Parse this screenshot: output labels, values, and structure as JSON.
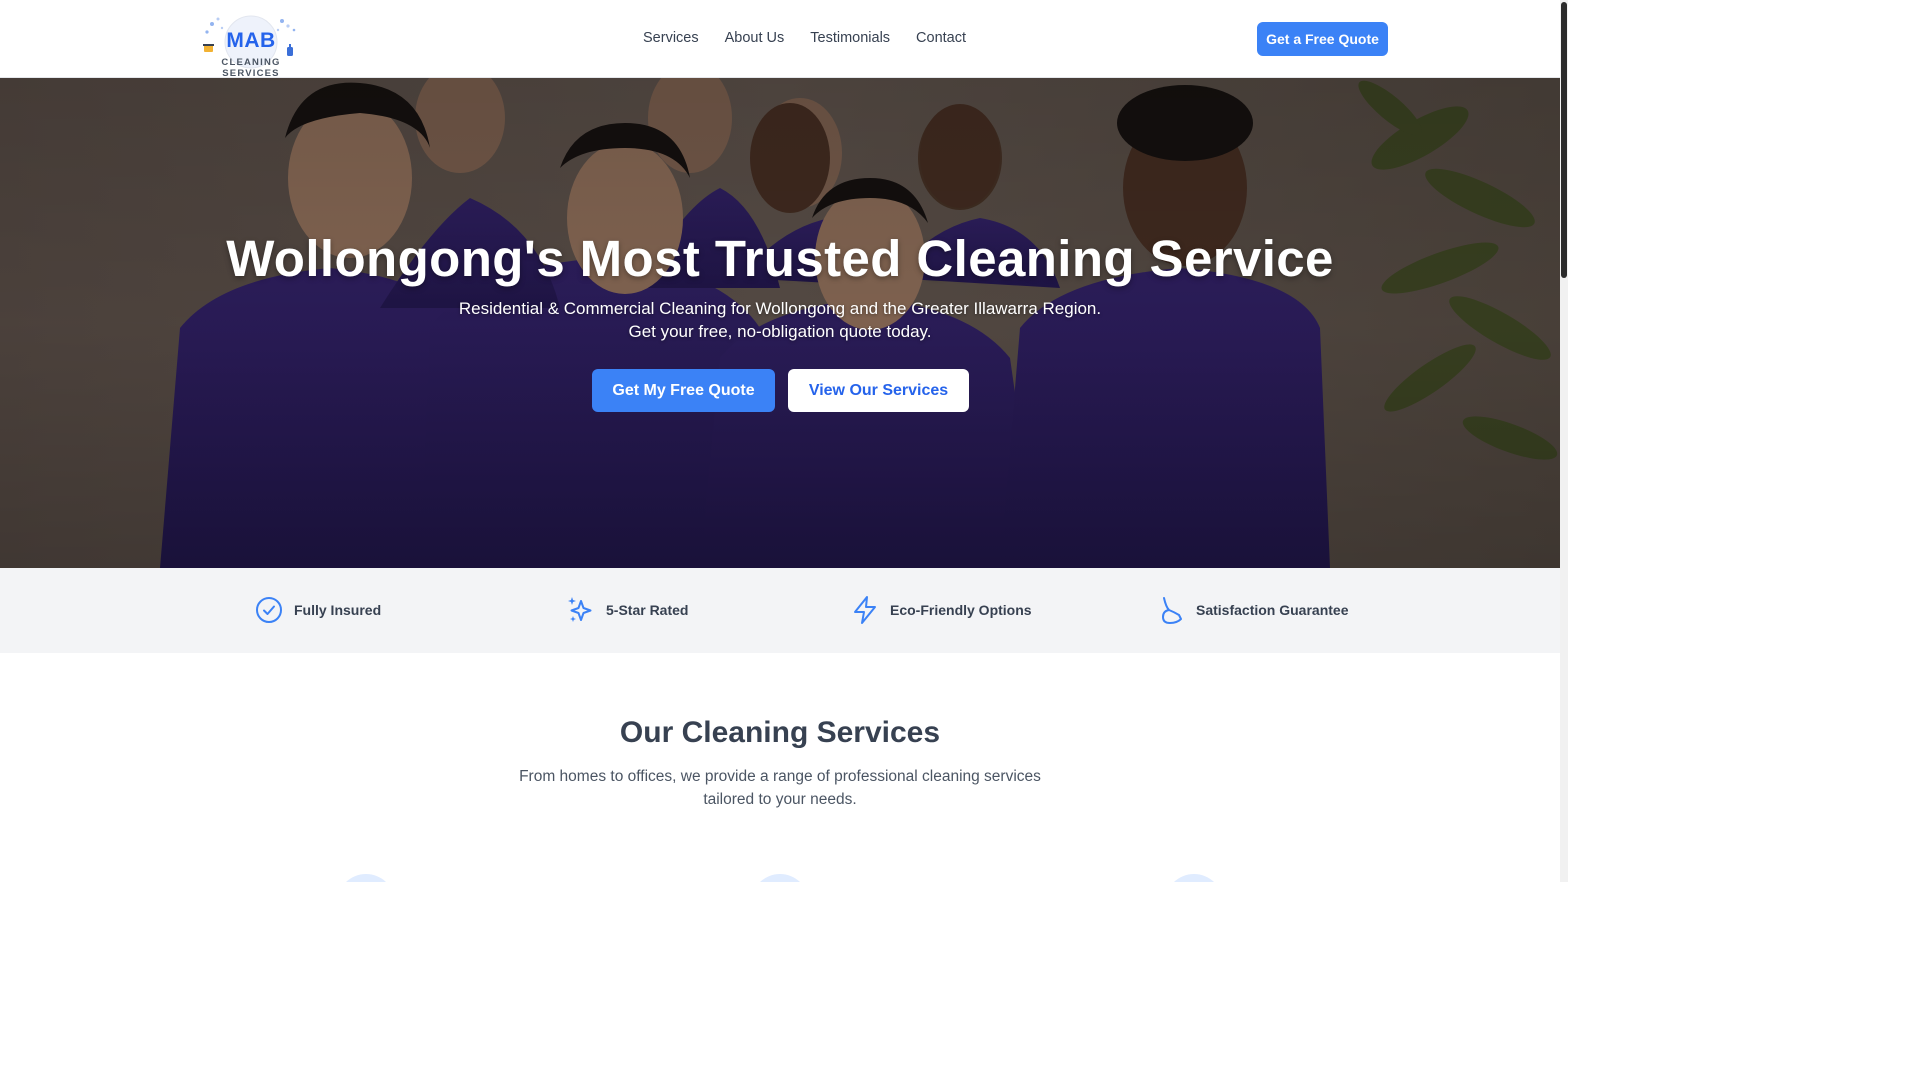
{
  "brand": {
    "logo_text": "MAB",
    "logo_subtitle": "CLEANING SERVICES",
    "primary_color": "#3b82f6",
    "accent_color": "#2563eb"
  },
  "nav": {
    "items": [
      {
        "label": "Services"
      },
      {
        "label": "About Us"
      },
      {
        "label": "Testimonials"
      },
      {
        "label": "Contact"
      }
    ],
    "cta_label": "Get a Free Quote"
  },
  "hero": {
    "title": "Wollongong's Most Trusted Cleaning Service",
    "subtitle_line1": "Residential & Commercial Cleaning for Wollongong and the Greater Illawarra Region.",
    "subtitle_line2": "Get your free, no-obligation quote today.",
    "primary_button": "Get My Free Quote",
    "secondary_button": "View Our Services",
    "background_description_icon": "team-photo"
  },
  "features": [
    {
      "icon": "check-circle-icon",
      "label": "Fully Insured"
    },
    {
      "icon": "sparkles-icon",
      "label": "5-Star Rated"
    },
    {
      "icon": "lightning-bolt-icon",
      "label": "Eco-Friendly Options"
    },
    {
      "icon": "thumbs-up-icon",
      "label": "Satisfaction Guarantee"
    }
  ],
  "services": {
    "title": "Our Cleaning Services",
    "description": "From homes to offices, we provide a range of professional cleaning services tailored to your needs."
  }
}
